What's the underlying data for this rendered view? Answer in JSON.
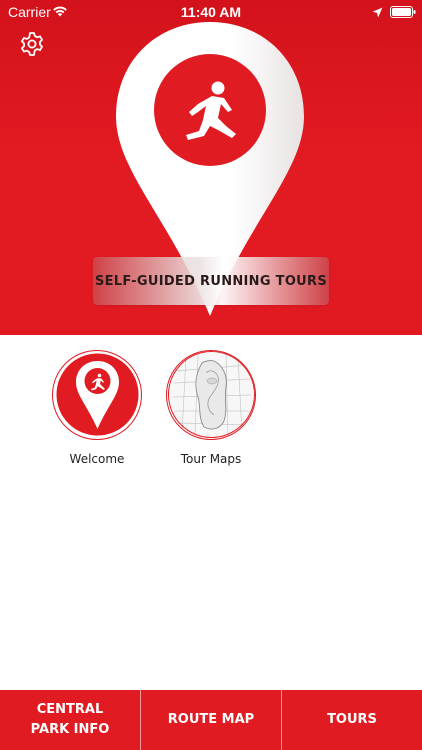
{
  "status_bar": {
    "carrier": "Carrier",
    "time": "11:40 AM",
    "wifi_icon": "wifi-icon",
    "location_icon": "location-arrow-icon",
    "battery_icon": "battery-icon"
  },
  "header": {
    "settings_icon": "gear-icon",
    "logo_icon": "runner-pin-icon",
    "banner_title": "SELF-GUIDED RUNNING TOURS"
  },
  "tiles": [
    {
      "label": "Welcome",
      "icon": "runner-pin-icon"
    },
    {
      "label": "Tour Maps",
      "icon": "map-thumbnail-icon"
    }
  ],
  "tabbar": {
    "tabs": [
      {
        "label": "CENTRAL\nPARK INFO"
      },
      {
        "label": "ROUTE MAP"
      },
      {
        "label": "TOURS"
      }
    ]
  },
  "colors": {
    "brand_red": "#e01b22",
    "white": "#ffffff",
    "text_dark": "#222222"
  }
}
